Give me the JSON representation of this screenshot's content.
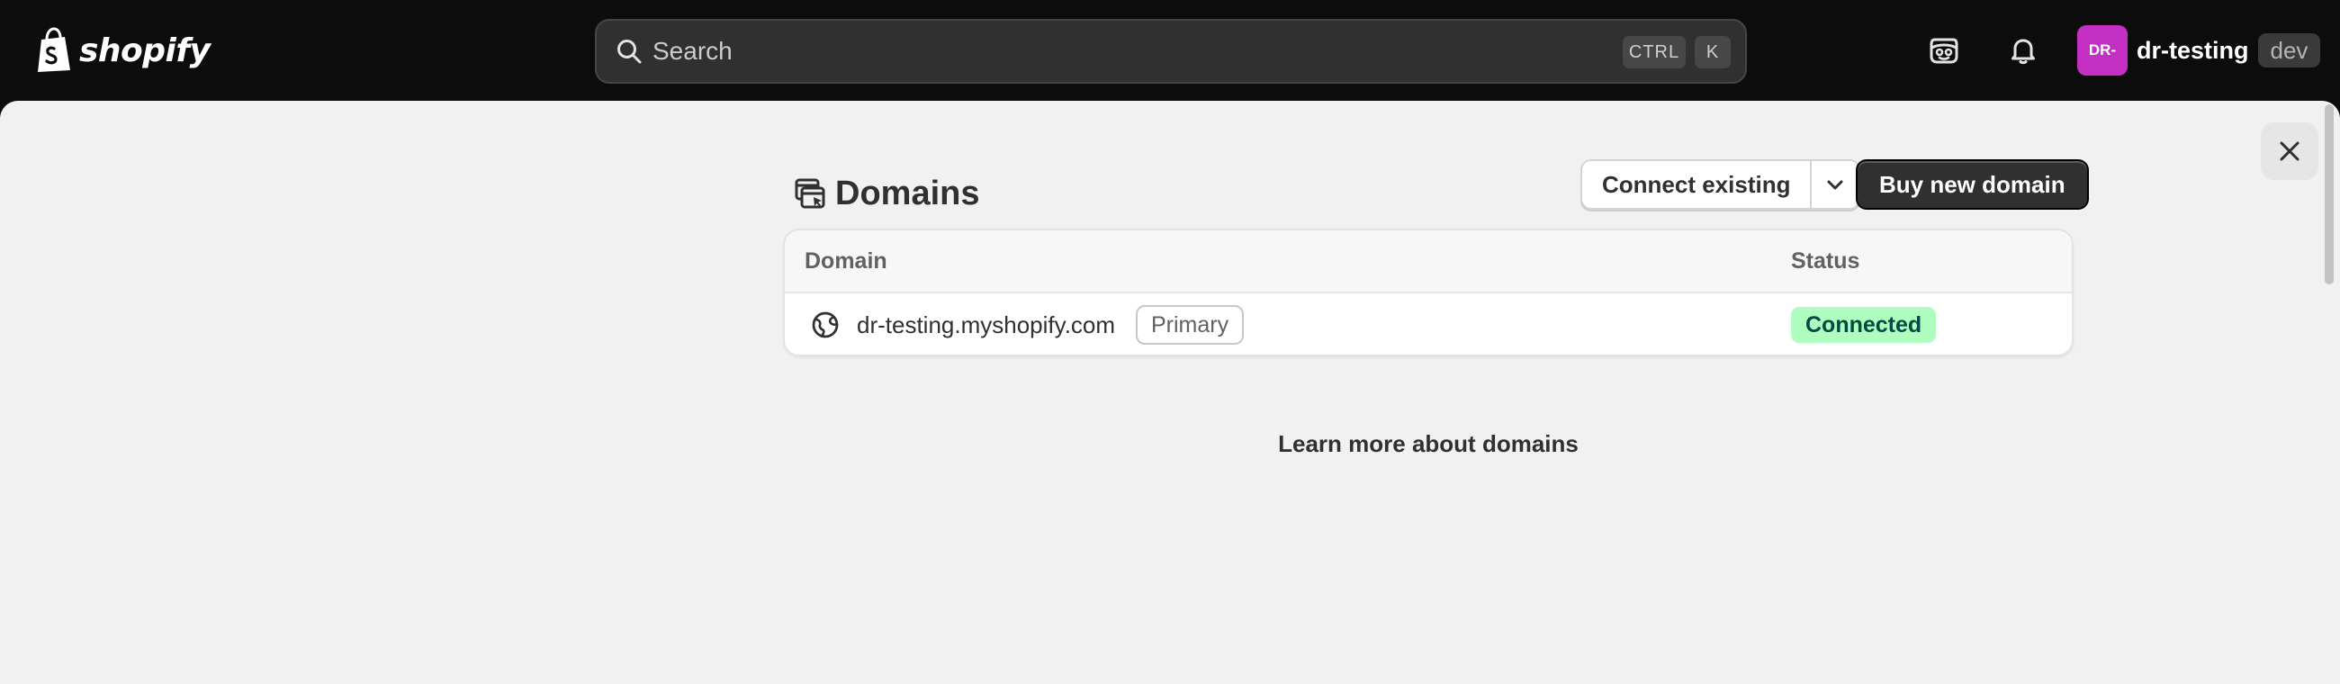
{
  "topbar": {
    "logo_text": "shopify",
    "search": {
      "placeholder": "Search",
      "shortcut_keys": [
        "CTRL",
        "K"
      ]
    },
    "icons": [
      "sidekick-icon",
      "bell-icon"
    ],
    "account": {
      "avatar_initials": "DR-",
      "avatar_color": "#c22fc2",
      "store_name": "dr-testing",
      "store_badge": "dev"
    }
  },
  "main": {
    "page_title": "Domains",
    "actions": {
      "connect_existing_label": "Connect existing",
      "buy_new_domain_label": "Buy new domain"
    },
    "table": {
      "columns": [
        "Domain",
        "Status"
      ],
      "rows": [
        {
          "domain": "dr-testing.myshopify.com",
          "badge": "Primary",
          "status": "Connected"
        }
      ]
    },
    "learn_more_link": "Learn more about domains"
  },
  "colors": {
    "topbar_bg": "#0c0c0c",
    "page_bg": "#f1f1f1",
    "primary_button": "#303030",
    "status_connected_bg": "#affebf",
    "status_connected_text": "#014b40"
  }
}
